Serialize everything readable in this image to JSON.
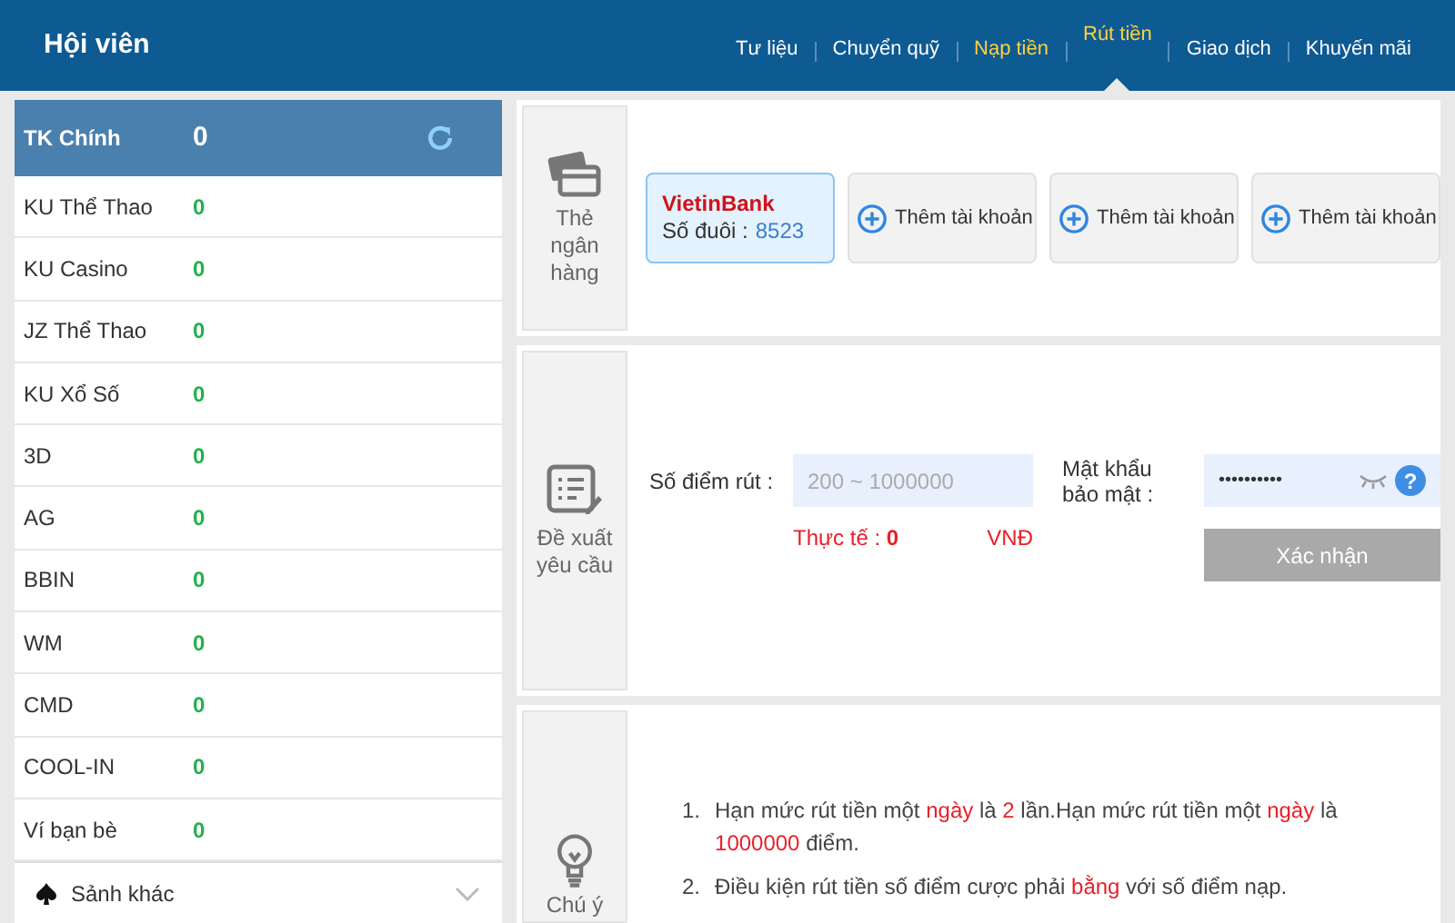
{
  "header": {
    "title": "Hội viên"
  },
  "tabs": [
    {
      "label": "Tư liệu",
      "selected": false,
      "highlight": false
    },
    {
      "label": "Chuyển quỹ",
      "selected": false,
      "highlight": false
    },
    {
      "label": "Nạp tiền",
      "selected": false,
      "highlight": true
    },
    {
      "label": "Rút tiền",
      "selected": true,
      "highlight": true
    },
    {
      "label": "Giao dịch",
      "selected": false,
      "highlight": false
    },
    {
      "label": "Khuyến mãi",
      "selected": false,
      "highlight": false
    }
  ],
  "sidebar": {
    "main": {
      "label": "TK Chính",
      "value": "0"
    },
    "items": [
      {
        "label": "KU Thể Thao",
        "value": "0"
      },
      {
        "label": "KU Casino",
        "value": "0"
      },
      {
        "label": "JZ Thể Thao",
        "value": "0"
      },
      {
        "label": "KU Xổ Số",
        "value": "0"
      },
      {
        "label": "3D",
        "value": "0"
      },
      {
        "label": "AG",
        "value": "0"
      },
      {
        "label": "BBIN",
        "value": "0"
      },
      {
        "label": "WM",
        "value": "0"
      },
      {
        "label": "CMD",
        "value": "0"
      },
      {
        "label": "COOL-IN",
        "value": "0"
      },
      {
        "label": "Ví bạn bè",
        "value": "0"
      }
    ],
    "more": {
      "label": "Sảnh khác",
      "expanded": false
    }
  },
  "bank_section": {
    "label": "Thẻ ngân hàng",
    "cards": [
      {
        "kind": "bank",
        "bank": "VietinBank",
        "caption": "Số đuôi :",
        "number": "8523",
        "selected": true
      },
      {
        "kind": "add",
        "label": "Thêm tài khoản",
        "selected": false
      },
      {
        "kind": "add",
        "label": "Thêm tài khoản",
        "selected": false
      },
      {
        "kind": "add",
        "label": "Thêm tài khoản",
        "selected": false
      }
    ]
  },
  "request_section": {
    "label": "Đề xuất yêu cầu",
    "amount_label": "Số điểm rút :",
    "amount_placeholder": "200 ~ 1000000",
    "actual": "Thực tế : **0**",
    "currency": "VNĐ",
    "password_label": "Mật khẩu bảo mật :",
    "password_value": "••••••••••",
    "help": "?",
    "submit": {
      "label": "Xác nhận",
      "disabled": true
    }
  },
  "notes_section": {
    "label": "Chú ý",
    "notes": [
      {
        "number": "1.",
        "segments": [
          {
            "text": "Hạn mức rút tiền một ",
            "red": false
          },
          {
            "text": "ngày",
            "red": true
          },
          {
            "text": " là ",
            "red": false
          },
          {
            "text": "2",
            "red": true
          },
          {
            "text": " lần.Hạn mức rút tiền một ",
            "red": false
          },
          {
            "text": "ngày",
            "red": true
          },
          {
            "text": " là ",
            "red": false
          },
          {
            "text": "1000000",
            "red": true
          },
          {
            "text": " điểm.",
            "red": false
          }
        ]
      },
      {
        "number": "2.",
        "segments": [
          {
            "text": "Điều kiện rút tiền số điểm cược phải ",
            "red": false
          },
          {
            "text": "bằng",
            "red": true
          },
          {
            "text": " với số điểm nạp.",
            "red": false
          }
        ]
      }
    ]
  }
}
